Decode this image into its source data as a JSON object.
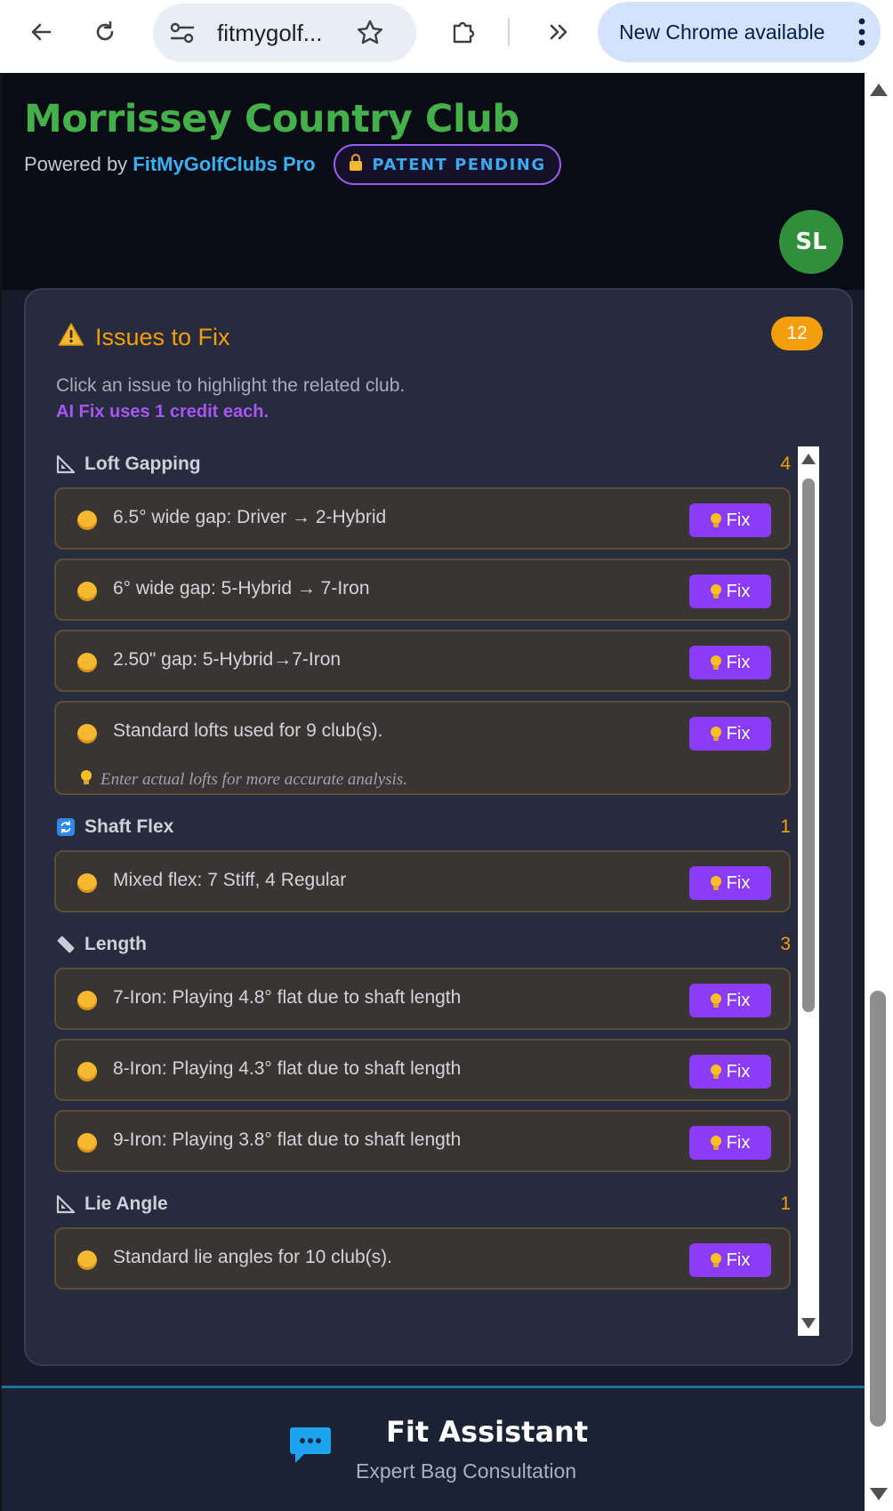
{
  "browser": {
    "url": "fitmygolf...",
    "update_label": "New Chrome available"
  },
  "header": {
    "title": "Morrissey Country Club",
    "powered_prefix": "Powered by ",
    "powered_brand": "FitMyGolfClubs Pro",
    "patent": "PATENT PENDING",
    "avatar_initials": "SL"
  },
  "panel": {
    "title": "Issues to Fix",
    "count": "12",
    "hint": "Click an issue to highlight the related club.",
    "credit_note": "AI Fix uses 1 credit each.",
    "fix_label": "Fix"
  },
  "sections": [
    {
      "label": "Loft Gapping",
      "count": "4",
      "icon": "triangle-ruler-icon",
      "issues": [
        {
          "text": "6.5° wide gap: Driver → 2-Hybrid"
        },
        {
          "text": "6° wide gap: 5-Hybrid → 7-Iron"
        },
        {
          "text": "2.50\" gap: 5-Hybrid→7-Iron"
        },
        {
          "text": "Standard lofts used for 9 club(s).",
          "sub": "Enter actual lofts for more accurate analysis."
        }
      ]
    },
    {
      "label": "Shaft Flex",
      "count": "1",
      "icon": "refresh-icon",
      "issues": [
        {
          "text": "Mixed flex: 7 Stiff, 4 Regular"
        }
      ]
    },
    {
      "label": "Length",
      "count": "3",
      "icon": "ruler-icon",
      "issues": [
        {
          "text": "7-Iron: Playing 4.8° flat due to shaft length"
        },
        {
          "text": "8-Iron: Playing 4.3° flat due to shaft length"
        },
        {
          "text": "9-Iron: Playing 3.8° flat due to shaft length"
        }
      ]
    },
    {
      "label": "Lie Angle",
      "count": "1",
      "icon": "triangle-ruler-icon",
      "issues": [
        {
          "text": "Standard lie angles for 10 club(s)."
        }
      ]
    }
  ],
  "footer": {
    "title": "Fit Assistant",
    "subtitle": "Expert Bag Consultation"
  },
  "colors": {
    "accent_green": "#43b04a",
    "brand_blue": "#3ab0f5",
    "warning_orange": "#f59e0b",
    "fix_purple": "#8b3cf6"
  }
}
